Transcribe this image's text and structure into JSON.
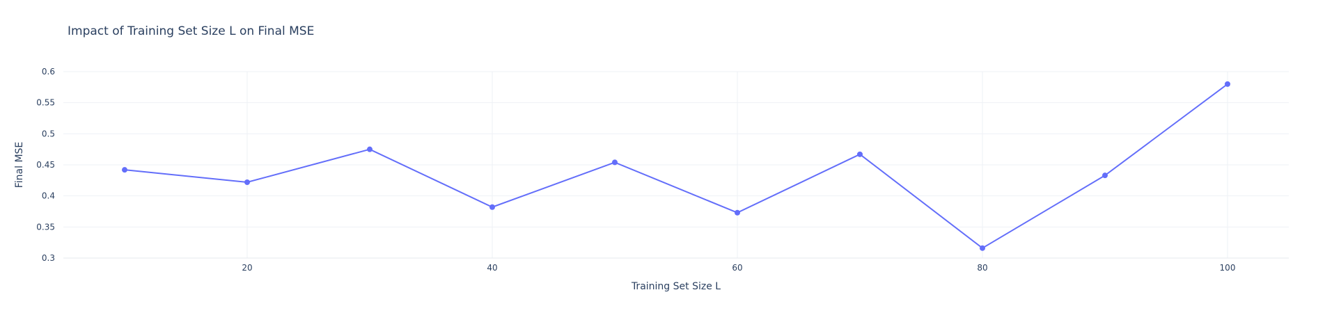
{
  "chart_data": {
    "type": "line",
    "title": "Impact of Training Set Size L on Final MSE",
    "xlabel": "Training Set Size L",
    "ylabel": "Final MSE",
    "x": [
      10,
      20,
      30,
      40,
      50,
      60,
      70,
      80,
      90,
      100
    ],
    "series": [
      {
        "values": [
          0.442,
          0.422,
          0.475,
          0.382,
          0.454,
          0.373,
          0.467,
          0.316,
          0.433,
          0.58
        ],
        "color": "#636efa"
      }
    ],
    "xlim": [
      5,
      105
    ],
    "ylim": [
      0.3,
      0.6
    ],
    "xticks": [
      20,
      40,
      60,
      80,
      100
    ],
    "yticks": [
      0.3,
      0.35,
      0.4,
      0.45,
      0.5,
      0.55,
      0.6
    ],
    "ytick_labels": [
      "0.3",
      "0.35",
      "0.4",
      "0.45",
      "0.5",
      "0.55",
      "0.6"
    ],
    "grid": true,
    "markers": true
  }
}
